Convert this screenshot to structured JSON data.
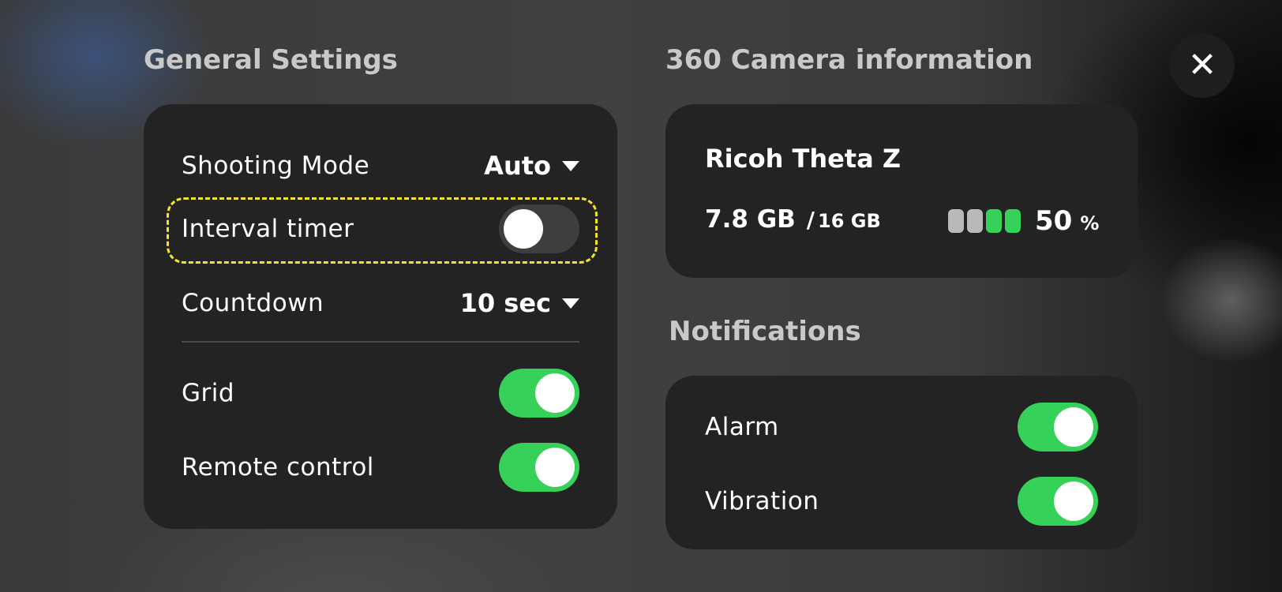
{
  "general": {
    "title": "General Settings",
    "shooting_mode": {
      "label": "Shooting Mode",
      "value": "Auto"
    },
    "interval_timer": {
      "label": "Interval timer",
      "enabled": false
    },
    "countdown": {
      "label": "Countdown",
      "value": "10 sec"
    },
    "grid": {
      "label": "Grid",
      "enabled": true
    },
    "remote_control": {
      "label": "Remote control",
      "enabled": true
    }
  },
  "camera": {
    "title": "360 Camera information",
    "name": "Ricoh Theta Z",
    "storage_used": "7.8 GB",
    "storage_separator": "/",
    "storage_total": "16 GB",
    "battery_percent": "50",
    "battery_unit": "%",
    "battery_level": 0.5
  },
  "notifications": {
    "title": "Notifications",
    "alarm": {
      "label": "Alarm",
      "enabled": true
    },
    "vibration": {
      "label": "Vibration",
      "enabled": true
    }
  },
  "close": {
    "icon": "close-icon",
    "glyph": "✕"
  },
  "colors": {
    "toggle_on": "#35d158",
    "toggle_off": "#3e3e41",
    "battery_filled": "#35d158",
    "battery_empty": "#b9b9b9",
    "highlight": "#f5e52a"
  }
}
